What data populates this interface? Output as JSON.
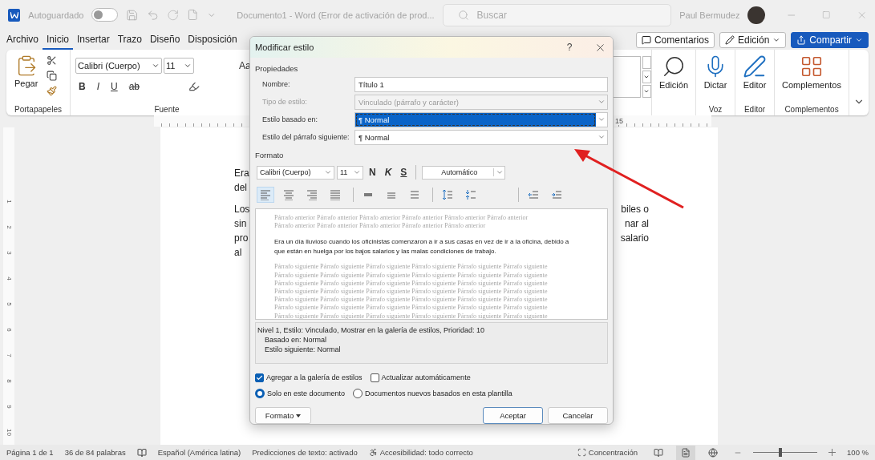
{
  "title_bar": {
    "autosave_label": "Autoguardado",
    "autosave_on": false,
    "document_title": "Documento1  -  Word (Error de activación de prod...",
    "search_placeholder": "Buscar",
    "user_name": "Paul Bermudez"
  },
  "ribbon_tabs": [
    {
      "label": "Archivo",
      "selected": false
    },
    {
      "label": "Inicio",
      "selected": true
    },
    {
      "label": "Insertar",
      "selected": false
    },
    {
      "label": "Trazo",
      "selected": false
    },
    {
      "label": "Diseño",
      "selected": false
    },
    {
      "label": "Disposición",
      "selected": false
    }
  ],
  "ribbon_actions": [
    {
      "label": "Comentarios",
      "kind": "comments"
    },
    {
      "label": "Edición",
      "kind": "editing"
    },
    {
      "label": "Compartir",
      "kind": "share"
    }
  ],
  "clipboard": {
    "paste_label": "Pegar",
    "group_label": "Portapapeles"
  },
  "font_group": {
    "font": "Calibri (Cuerpo)",
    "size": "11",
    "case_label": "Aa",
    "format_buttons": [
      "B",
      "I",
      "U"
    ],
    "strike": "ab",
    "group_label": "Fuente"
  },
  "right_groups": [
    {
      "kind": "search",
      "button": "Edición"
    },
    {
      "kind": "mic",
      "button": "Dictar",
      "group": "Voz"
    },
    {
      "kind": "pen",
      "button": "Editor",
      "group": "Editor"
    },
    {
      "kind": "grid",
      "button": "Complementos",
      "group": "Complementos"
    }
  ],
  "ruler_label": "15",
  "vertical_ruler": [
    "1",
    "2",
    "3",
    "4",
    "5",
    "6",
    "7",
    "8",
    "9",
    "10"
  ],
  "document_paragraphs": [
    {
      "lines": [
        {
          "start": "Era"
        },
        {
          "start": "del"
        }
      ]
    },
    {
      "lines": [
        {
          "start": "Los",
          "end": "biles o"
        },
        {
          "start": "sin",
          "end": "nar al"
        },
        {
          "start": "pro",
          "end": "salario"
        },
        {
          "start": "al"
        }
      ]
    }
  ],
  "dialog": {
    "title": "Modificar estilo",
    "help": "?",
    "properties_label": "Propiedades",
    "fields": [
      {
        "label": "Nombre:",
        "value": "Título 1",
        "kind": "text",
        "disabled": false,
        "selected": false
      },
      {
        "label": "Tipo de estilo:",
        "value": "Vinculado (párrafo y carácter)",
        "kind": "select",
        "disabled": true,
        "selected": false
      },
      {
        "label": "Estilo basado en:",
        "value": "¶ Normal",
        "kind": "select",
        "disabled": false,
        "selected": true
      },
      {
        "label": "Estilo del párrafo siguiente:",
        "value": "¶ Normal",
        "kind": "select",
        "disabled": false,
        "selected": false
      }
    ],
    "format_label": "Formato",
    "font": "Calibri (Cuerpo)",
    "size": "11",
    "style_buttons": [
      "N",
      "K",
      "S"
    ],
    "font_color": "Automático",
    "paragraph_buttons": [
      {
        "kind": "left",
        "selected": true
      },
      {
        "kind": "center",
        "selected": false
      },
      {
        "kind": "right",
        "selected": false
      },
      {
        "kind": "justify",
        "selected": false
      },
      {
        "kind": "single",
        "selected": false
      },
      {
        "kind": "onehalf",
        "selected": false
      },
      {
        "kind": "double",
        "selected": false
      },
      {
        "kind": "spacing-up",
        "selected": false
      },
      {
        "kind": "spacing-down",
        "selected": false
      },
      {
        "kind": "outdent",
        "selected": false
      },
      {
        "kind": "indent",
        "selected": false
      }
    ],
    "preview_before": [
      "Párrafo anterior Párrafo anterior Párrafo anterior Párrafo anterior Párrafo anterior Párrafo anterior",
      "Párrafo anterior Párrafo anterior Párrafo anterior Párrafo anterior Párrafo anterior"
    ],
    "preview_sample": "Era un día lluvioso cuando los oficinistas comenzaron a ir a sus casas en vez de ir a la oficina, debido a que están en huelga por los bajos salarios y las malas condiciones de trabajo.",
    "preview_after": [
      "Párrafo siguiente Párrafo siguiente Párrafo siguiente Párrafo siguiente Párrafo siguiente Párrafo siguiente",
      "Párrafo siguiente Párrafo siguiente Párrafo siguiente Párrafo siguiente Párrafo siguiente Párrafo siguiente",
      "Párrafo siguiente Párrafo siguiente Párrafo siguiente Párrafo siguiente Párrafo siguiente Párrafo siguiente",
      "Párrafo siguiente Párrafo siguiente Párrafo siguiente Párrafo siguiente Párrafo siguiente Párrafo siguiente",
      "Párrafo siguiente Párrafo siguiente Párrafo siguiente Párrafo siguiente Párrafo siguiente Párrafo siguiente",
      "Párrafo siguiente Párrafo siguiente Párrafo siguiente Párrafo siguiente Párrafo siguiente Párrafo siguiente",
      "Párrafo siguiente Párrafo siguiente Párrafo siguiente Párrafo siguiente Párrafo siguiente Párrafo siguiente"
    ],
    "description": [
      "Nivel 1, Estilo: Vinculado, Mostrar en la galería de estilos, Prioridad: 10",
      "Basado en: Normal",
      "Estilo siguiente: Normal"
    ],
    "checkboxes": [
      {
        "label": "Agregar a la galería de estilos",
        "checked": true
      },
      {
        "label": "Actualizar automáticamente",
        "checked": false
      }
    ],
    "radios": [
      {
        "label": "Solo en este documento",
        "selected": true
      },
      {
        "label": "Documentos nuevos basados en esta plantilla",
        "selected": false
      }
    ],
    "buttons": [
      {
        "label": "Formato",
        "kind": "menu"
      },
      {
        "label": "Aceptar",
        "kind": "default"
      },
      {
        "label": "Cancelar",
        "kind": "plain"
      }
    ]
  },
  "status_bar": {
    "page": "Página 1 de 1",
    "words": "36 de 84 palabras",
    "language": "Español (América latina)",
    "predictions": "Predicciones de texto: activado",
    "accessibility": "Accesibilidad: todo correcto",
    "focus": "Concentración",
    "views": [
      {
        "kind": "read",
        "selected": false
      },
      {
        "kind": "print",
        "selected": true
      },
      {
        "kind": "web",
        "selected": false
      }
    ],
    "zoom": {
      "level": 0.42,
      "label": "100 %"
    }
  }
}
